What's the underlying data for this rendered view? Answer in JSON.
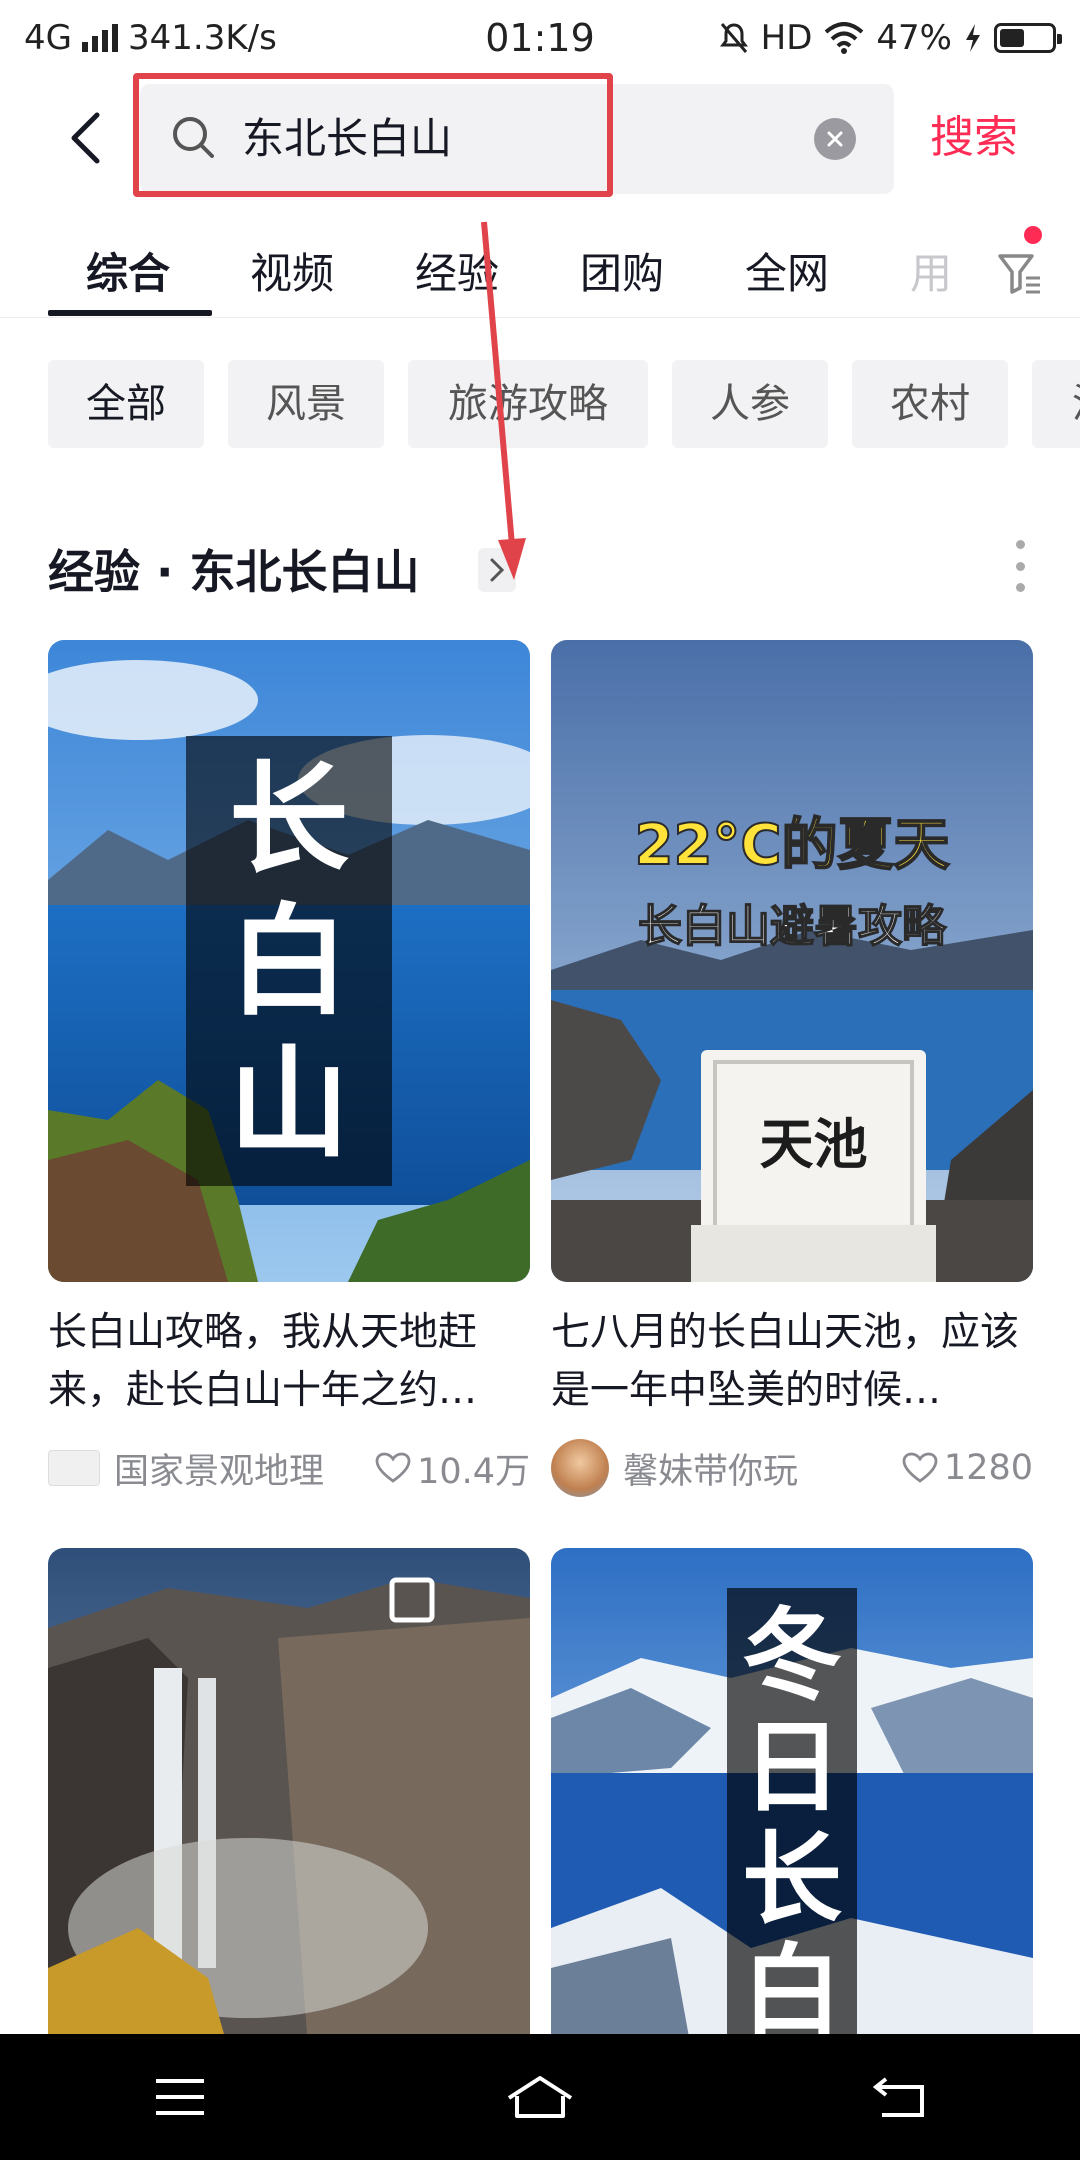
{
  "status_bar": {
    "network": "4G",
    "speed": "341.3K/s",
    "time": "01:19",
    "hd": "HD",
    "battery_percent": "47%",
    "battery_level": 0.47
  },
  "search": {
    "query": "东北长白山",
    "submit_label": "搜索"
  },
  "tabs": [
    {
      "label": "综合",
      "active": true
    },
    {
      "label": "视频"
    },
    {
      "label": "经验"
    },
    {
      "label": "团购"
    },
    {
      "label": "全网"
    },
    {
      "label": "用"
    }
  ],
  "chips": [
    "全部",
    "风景",
    "旅游攻略",
    "人参",
    "农村",
    "温"
  ],
  "section": {
    "title": "经验 · 东北长白山"
  },
  "cards": [
    {
      "overlay": "长白山",
      "title": "长白山攻略，我从天地赶来，赴长白山十年之约…",
      "author": "国家景观地理",
      "likes": "10.4万"
    },
    {
      "overlay_line1": "22°C的夏天",
      "overlay_line2": "长白山避暑攻略",
      "sign_text": "天池",
      "title": "七八月的长白山天池，应该是一年中坠美的时候…",
      "author": "馨妹带你玩",
      "likes": "1280"
    },
    {
      "overlay": ""
    },
    {
      "overlay": "冬日长白"
    }
  ],
  "colors": {
    "accent": "#fe2c55",
    "annotation": "#e0434a"
  }
}
